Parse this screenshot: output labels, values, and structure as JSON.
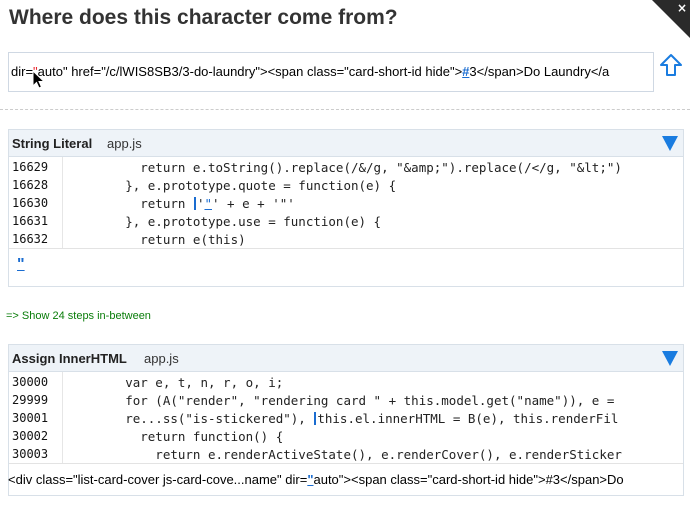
{
  "title": "Where does this character come from?",
  "close_icon": "×",
  "html_bar": {
    "before": "dir=",
    "quote": "\"",
    "mid": "auto\" href=\"/c/lWIS8SB3/3-do-laundry\"><span class=\"card-short-id hide\">",
    "hash": "#",
    "after": "3</span>Do Laundry</a"
  },
  "panel1": {
    "title": "String Literal",
    "file": "app.js",
    "lines": [
      {
        "no": "16629",
        "code": "          return e.toString().replace(/&/g, \"&amp;\").replace(/</g, \"&lt;\")"
      },
      {
        "no": "16628",
        "code": "        }, e.prototype.quote = function(e) {"
      },
      {
        "no": "16630",
        "pre": "          return ",
        "quote_pre": "'",
        "quote_hl": "\"",
        "post": "' + e + '\"'"
      },
      {
        "no": "16631",
        "code": "        }, e.prototype.use = function(e) {"
      },
      {
        "no": "16632",
        "code": "          return e(this)"
      }
    ],
    "value": "\""
  },
  "steps_link": "=> Show 24 steps in-between",
  "panel2": {
    "title": "Assign InnerHTML",
    "file": "app.js",
    "lines": [
      {
        "no": "30000",
        "code": "        var e, t, n, r, o, i;"
      },
      {
        "no": "29999",
        "code": "        for (A(\"render\", \"rendering card \" + this.model.get(\"name\")), e ="
      },
      {
        "no": "30001",
        "pre": "        re...ss(\"is-stickered\"), ",
        "post": "this.el.innerHTML = B(e), this.renderFil"
      },
      {
        "no": "30002",
        "code": "          return function() {"
      },
      {
        "no": "30003",
        "code": "            return e.renderActiveState(), e.renderCover(), e.renderSticker"
      }
    ]
  },
  "inner_html": {
    "before": "<div class=\"list-card-cover js-card-cove...name\" dir=",
    "quote": "\"",
    "after": "auto\"><span class=\"card-short-id hide\">#3</span>Do"
  },
  "colors": {
    "accent": "#1a7ce0",
    "highlight_red": "#e8232b",
    "steps_green": "#0a7d0a",
    "panel_header": "#eef3f8"
  },
  "icons": {
    "close": "close-icon",
    "upload": "arrow-up-icon",
    "collapse": "triangle-down-icon",
    "cursor": "mouse-pointer-icon"
  }
}
